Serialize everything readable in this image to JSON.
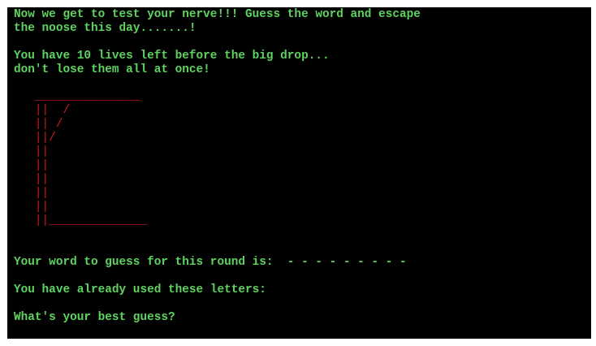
{
  "terminal": {
    "intro_line1": "Now we get to test your nerve!!! Guess the word and escape",
    "intro_line2": "the noose this day.......!",
    "lives_line1": "You have 10 lives left before the big drop...",
    "lives_line2": "don't lose them all at once!",
    "gallows_art": "   _______________\n   ||  /\n   || /\n   ||/\n   ||\n   ||\n   ||\n   ||\n   ||\n   ||______________",
    "word_prompt": "Your word to guess for this round is:  - - - - - - - - -",
    "used_letters_prompt": "You have already used these letters:",
    "guess_prompt": "What's your best guess?"
  },
  "colors": {
    "text": "#5fd35f",
    "gallows": "#cc1a1a",
    "background": "#000000"
  }
}
